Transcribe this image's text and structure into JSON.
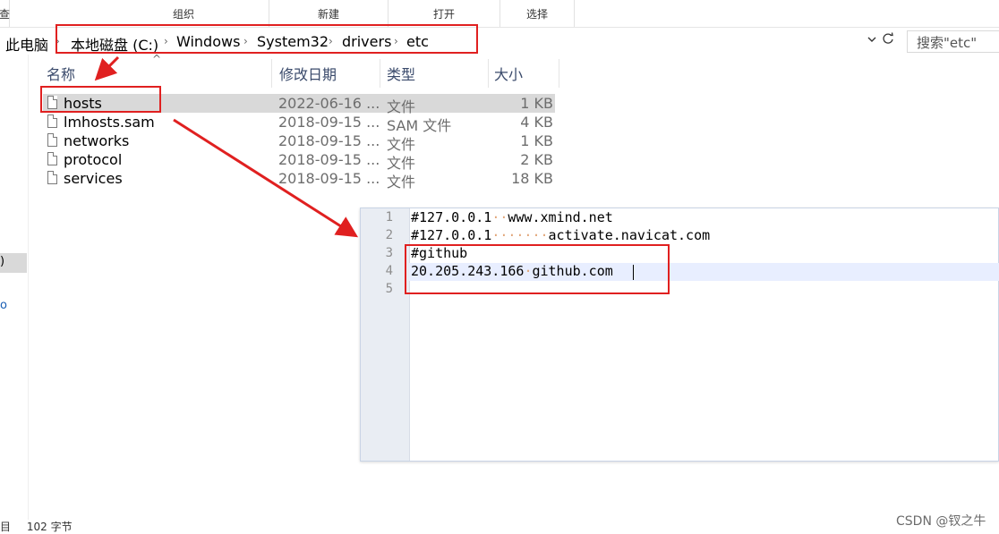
{
  "ribbon": {
    "partial_left": "查",
    "groups": [
      "组织",
      "新建",
      "打开",
      "选择"
    ]
  },
  "address": {
    "root": "此电脑",
    "crumbs": [
      "本地磁盘 (C:)",
      "Windows",
      "System32",
      "drivers",
      "etc"
    ],
    "separator": "›",
    "search_placeholder": "搜索\"etc\"",
    "dropdown_icon": "chevron-down-icon",
    "refresh_icon": "refresh-icon"
  },
  "navpane": {
    "selected_partial": ")",
    "partial_mark": "o"
  },
  "columns": {
    "name": "名称",
    "modified": "修改日期",
    "type": "类型",
    "size": "大小",
    "sort_caret": "^"
  },
  "files": [
    {
      "name": "hosts",
      "modified": "2022-06-16 ...",
      "type": "文件",
      "size": "1 KB",
      "selected": true
    },
    {
      "name": "lmhosts.sam",
      "modified": "2018-09-15 ...",
      "type": "SAM 文件",
      "size": "4 KB",
      "selected": false
    },
    {
      "name": "networks",
      "modified": "2018-09-15 ...",
      "type": "文件",
      "size": "1 KB",
      "selected": false
    },
    {
      "name": "protocol",
      "modified": "2018-09-15 ...",
      "type": "文件",
      "size": "2 KB",
      "selected": false
    },
    {
      "name": "services",
      "modified": "2018-09-15 ...",
      "type": "文件",
      "size": "18 KB",
      "selected": false
    }
  ],
  "editor": {
    "line_numbers": [
      "1",
      "2",
      "3",
      "4",
      "5"
    ],
    "lines": [
      {
        "pre": "#127.0.0.1",
        "dots": "··",
        "post": "www.xmind.net"
      },
      {
        "pre": "#127.0.0.1",
        "dots": "·······",
        "post": "activate.navicat.com"
      },
      {
        "pre": "#github",
        "dots": "",
        "post": ""
      },
      {
        "pre": "20.205.243.166",
        "dots": "·",
        "post": "github.com"
      },
      {
        "pre": "",
        "dots": "",
        "post": ""
      }
    ]
  },
  "status": {
    "items_partial": "目",
    "size_text": "102 字节"
  },
  "watermark": "CSDN @钗之牛",
  "colors": {
    "annotation_red": "#e02020",
    "selection_gray": "#d9d9d9",
    "gutter": "#e9edf3",
    "current_line": "#e8eeff",
    "whitespace_dot": "#e2a679"
  }
}
